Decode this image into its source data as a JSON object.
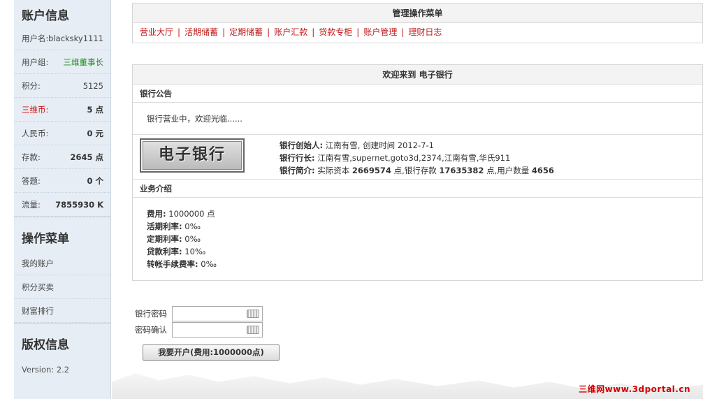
{
  "sidebar": {
    "account_title": "账户信息",
    "rows": [
      {
        "label": "用户名:",
        "value": "blacksky1111"
      },
      {
        "label": "用户组:",
        "value": "三维董事长"
      },
      {
        "label": "积分:",
        "value": "5125"
      },
      {
        "label": "三维币:",
        "value": "5 点"
      },
      {
        "label": "人民币:",
        "value": "0 元"
      },
      {
        "label": "存款:",
        "value": "2645 点"
      },
      {
        "label": "答题:",
        "value": "0 个"
      },
      {
        "label": "流量:",
        "value": "7855930 K"
      }
    ],
    "menu_title": "操作菜单",
    "menu_items": [
      "我的账户",
      "积分买卖",
      "财富排行"
    ],
    "copyright_title": "版权信息",
    "version": "Version: 2.2"
  },
  "main": {
    "menu_header": "管理操作菜单",
    "menu_links": [
      "营业大厅",
      "活期储蓄",
      "定期储蓄",
      "账户汇款",
      "贷款专柜",
      "账户管理",
      "理财日志"
    ],
    "welcome_header": "欢迎来到 电子银行",
    "notice_title": "银行公告",
    "notice_text": "银行营业中，欢迎光临......",
    "logo_text": "电子银行",
    "founder_label": "银行创始人:",
    "founder_value": "江南有雪, 创建时间 2012-7-1",
    "president_label": "银行行长:",
    "president_value": "江南有雪,supernet,goto3d,2374,江南有雪,华氏911",
    "intro_label": "银行简介:",
    "intro_capital_label": "实际资本",
    "intro_capital": "2669574",
    "intro_deposit_label": "点,银行存款",
    "intro_deposit": "17635382",
    "intro_users_label": "点,用户数量",
    "intro_users": "4656",
    "business_title": "业务介绍",
    "business": [
      {
        "label": "费用:",
        "value": "1000000 点"
      },
      {
        "label": "活期利率:",
        "value": "0‰"
      },
      {
        "label": "定期利率:",
        "value": "0‰"
      },
      {
        "label": "贷款利率:",
        "value": "10‰"
      },
      {
        "label": "转帐手续费率:",
        "value": "0‰"
      }
    ]
  },
  "form": {
    "password_label": "银行密码",
    "confirm_label": "密码确认",
    "submit_label": "我要开户(费用:1000000点)"
  },
  "watermark": "三维网www.3dportal.cn"
}
